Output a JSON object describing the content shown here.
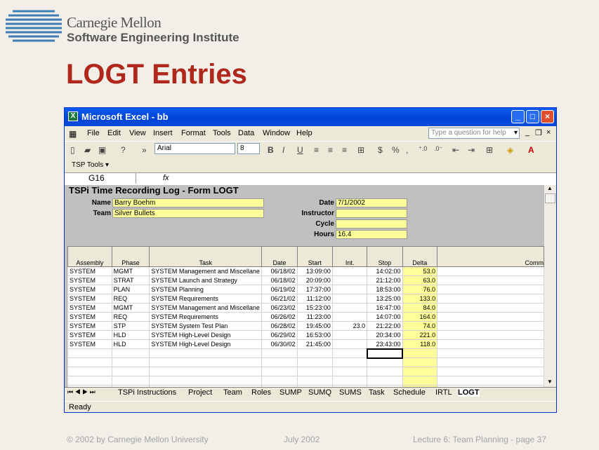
{
  "slide": {
    "org_line1": "Carnegie Mellon",
    "org_line2": "Software Engineering Institute",
    "title": "LOGT Entries",
    "footer_left": "© 2002 by Carnegie Mellon University",
    "footer_center": "July 2002",
    "footer_right": "Lecture 6: Team Planning - page 37"
  },
  "window": {
    "title": "Microsoft Excel - bb",
    "menus": [
      "File",
      "Edit",
      "View",
      "Insert",
      "Format",
      "Tools",
      "Data",
      "Window",
      "Help"
    ],
    "help_placeholder": "Type a question for help",
    "font": "Arial",
    "font_size": "8",
    "tsp_tools": "TSP Tools ▾",
    "cell_ref": "G16",
    "fx": "fx",
    "status": "Ready"
  },
  "form": {
    "title": "TSPi Time Recording Log - Form LOGT",
    "name_label": "Name",
    "name_value": "Barry Boehm",
    "team_label": "Team",
    "team_value": "Silver Bullets",
    "date_label": "Date",
    "date_value": "7/1/2002",
    "instructor_label": "Instructor",
    "instructor_value": "",
    "cycle_label": "Cycle",
    "cycle_value": "",
    "hours_label": "Hours",
    "hours_value": "16.4"
  },
  "table": {
    "headers": [
      "Assembly",
      "Phase",
      "Task",
      "Date",
      "Start",
      "Int.",
      "Stop",
      "Delta",
      "Comm"
    ],
    "rows": [
      [
        "SYSTEM",
        "MGMT",
        "SYSTEM Management and Miscellane",
        "06/18/02",
        "13:09:00",
        "",
        "14:02:00",
        "53.0"
      ],
      [
        "SYSTEM",
        "STRAT",
        "SYSTEM Launch and Strategy",
        "06/18/02",
        "20:09:00",
        "",
        "21:12:00",
        "63.0"
      ],
      [
        "SYSTEM",
        "PLAN",
        "SYSTEM Planning",
        "06/19/02",
        "17:37:00",
        "",
        "18:53:00",
        "76.0"
      ],
      [
        "SYSTEM",
        "REQ",
        "SYSTEM Requirements",
        "06/21/02",
        "11:12:00",
        "",
        "13:25:00",
        "133.0"
      ],
      [
        "SYSTEM",
        "MGMT",
        "SYSTEM Management and Miscellane",
        "06/23/02",
        "15:23:00",
        "",
        "16:47:00",
        "84.0"
      ],
      [
        "SYSTEM",
        "REQ",
        "SYSTEM Requirements",
        "06/26/02",
        "11:23:00",
        "",
        "14:07:00",
        "164.0"
      ],
      [
        "SYSTEM",
        "STP",
        "SYSTEM System Test Plan",
        "06/28/02",
        "19:45:00",
        "23.0",
        "21:22:00",
        "74.0"
      ],
      [
        "SYSTEM",
        "HLD",
        "SYSTEM High-Level Design",
        "06/29/02",
        "16:53:00",
        "",
        "20:34:00",
        "221.0"
      ],
      [
        "SYSTEM",
        "HLD",
        "SYSTEM High-Level Design",
        "06/30/02",
        "21:45:00",
        "",
        "23:43:00",
        "118.0"
      ]
    ]
  },
  "sheet_tabs": [
    "TSPi Instructions",
    "Project",
    "Team",
    "Roles",
    "SUMP",
    "SUMQ",
    "SUMS",
    "Task",
    "Schedule",
    "IRTL",
    "LOGT"
  ]
}
